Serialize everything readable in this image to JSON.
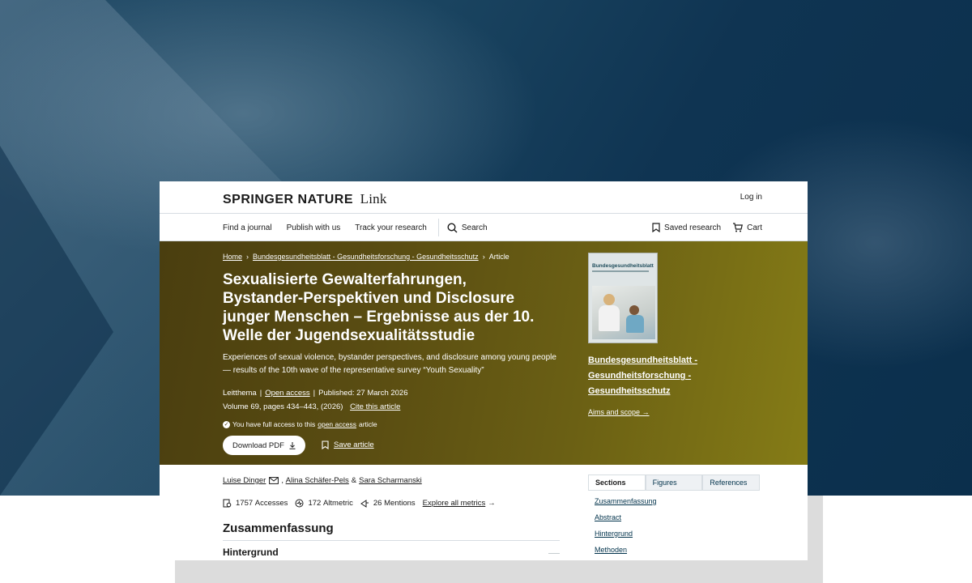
{
  "header": {
    "brand_bold": "SPRINGER NATURE",
    "brand_light": "Link",
    "login": "Log in"
  },
  "nav": {
    "items": [
      "Find a journal",
      "Publish with us",
      "Track your research"
    ],
    "search": "Search",
    "saved": "Saved research",
    "cart": "Cart"
  },
  "breadcrumb": {
    "home": "Home",
    "journal": "Bundesgesundheitsblatt - Gesundheitsforschung - Gesundheitsschutz",
    "current": "Article"
  },
  "article": {
    "title": "Sexualisierte Gewalterfahrungen, Bystander-Perspektiven und Disclosure junger Menschen – Ergebnisse aus der 10. Welle der Jugendsexualitätsstudie",
    "subtitle": "Experiences of sexual violence, bystander perspectives, and disclosure among young people — results of the 10th wave of the representative survey “Youth Sexuality”",
    "type": "Leitthema",
    "open_access": "Open access",
    "published": "Published: 27 March 2026",
    "volume": "Volume 69, pages 434–443, (2026)",
    "cite": "Cite this article",
    "access_prefix": "You have full access to this",
    "access_link": "open access",
    "access_suffix": "article",
    "download": "Download PDF",
    "save": "Save article"
  },
  "journal": {
    "cover_title": "Bundesgesundheitsblatt",
    "name": "Bundesgesundheitsblatt - Gesundheitsforschung - Gesundheitsschutz",
    "aims": "Aims and scope"
  },
  "authors": {
    "a1": "Luise Dinger",
    "a2": "Alina Schäfer-Pels",
    "amp": "&",
    "a3": "Sara Scharmanski"
  },
  "metrics": {
    "accesses_value": "1757",
    "accesses_label": "Accesses",
    "altmetric_value": "172",
    "altmetric_label": "Altmetric",
    "mentions_value": "26",
    "mentions_label": "Mentions",
    "explore": "Explore all metrics"
  },
  "content": {
    "heading": "Zusammenfassung",
    "subheading": "Hintergrund"
  },
  "sidebar": {
    "tabs": [
      "Sections",
      "Figures",
      "References"
    ],
    "sections": [
      "Zusammenfassung",
      "Abstract",
      "Hintergrund",
      "Methoden"
    ]
  }
}
